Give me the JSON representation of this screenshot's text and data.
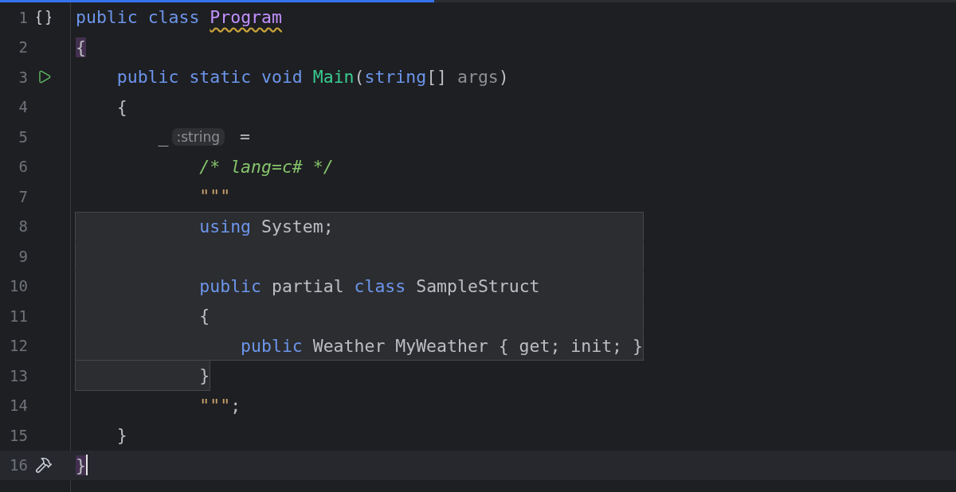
{
  "progress": {
    "level": 0.454
  },
  "lines": [
    {
      "number": "1",
      "gutter_icon": {
        "kind": "braces"
      },
      "current": false,
      "injected": false,
      "tokens": [
        {
          "kind": "keyword",
          "text": "public"
        },
        {
          "kind": "keyword",
          "text": " class"
        },
        {
          "kind": "class",
          "text": " Program",
          "warning": true
        }
      ]
    },
    {
      "number": "2",
      "current": false,
      "injected": false,
      "tokens": [
        {
          "kind": "plain",
          "text": "{",
          "matched": true
        }
      ]
    },
    {
      "number": "3",
      "gutter_icon": {
        "kind": "run"
      },
      "current": false,
      "injected": false,
      "tokens": [
        {
          "kind": "keyword",
          "text": "    public"
        },
        {
          "kind": "keyword",
          "text": " static"
        },
        {
          "kind": "keyword",
          "text": " void"
        },
        {
          "kind": "method",
          "text": " Main"
        },
        {
          "kind": "plain",
          "text": "("
        },
        {
          "kind": "keyword",
          "text": "string"
        },
        {
          "kind": "plain",
          "text": "[]"
        },
        {
          "kind": "param",
          "text": " args"
        },
        {
          "kind": "plain",
          "text": ")"
        }
      ]
    },
    {
      "number": "4",
      "current": false,
      "injected": false,
      "tokens": [
        {
          "kind": "plain",
          "text": "    {"
        }
      ]
    },
    {
      "number": "5",
      "current": false,
      "injected": false,
      "tokens": [
        {
          "kind": "plain",
          "text": "        _"
        },
        {
          "kind": "hint",
          "text": ":string"
        },
        {
          "kind": "plain",
          "text": " ="
        }
      ]
    },
    {
      "number": "6",
      "current": false,
      "injected": false,
      "tokens": [
        {
          "kind": "comment",
          "text": "            /* lang=c# */"
        }
      ]
    },
    {
      "number": "7",
      "current": false,
      "injected": false,
      "tokens": [
        {
          "kind": "string",
          "text": "            \"\"\""
        }
      ]
    },
    {
      "number": "8",
      "current": false,
      "injected": true,
      "tokens": [
        {
          "kind": "keyword",
          "text": "            using"
        },
        {
          "kind": "plain",
          "text": " System;"
        }
      ]
    },
    {
      "number": "9",
      "current": false,
      "injected": true
    },
    {
      "number": "10",
      "current": false,
      "injected": true,
      "tokens": [
        {
          "kind": "keyword",
          "text": "            public"
        },
        {
          "kind": "plain",
          "text": " partial"
        },
        {
          "kind": "keyword",
          "text": " class"
        },
        {
          "kind": "plain",
          "text": " SampleStruct"
        }
      ]
    },
    {
      "number": "11",
      "current": false,
      "injected": true,
      "tokens": [
        {
          "kind": "plain",
          "text": "            {"
        }
      ]
    },
    {
      "number": "12",
      "current": false,
      "injected": true,
      "tokens": [
        {
          "kind": "keyword",
          "text": "                public"
        },
        {
          "kind": "plain",
          "text": " Weather MyWeather { get; init; }"
        }
      ]
    },
    {
      "number": "13",
      "current": false,
      "injected": true,
      "tokens": [
        {
          "kind": "plain",
          "text": "            }"
        }
      ]
    },
    {
      "number": "14",
      "current": false,
      "injected": false,
      "tokens": [
        {
          "kind": "string",
          "text": "            \"\"\""
        },
        {
          "kind": "plain",
          "text": ";"
        }
      ]
    },
    {
      "number": "15",
      "current": false,
      "injected": false,
      "tokens": [
        {
          "kind": "plain",
          "text": "    }"
        }
      ]
    },
    {
      "number": "16",
      "gutter_icon": {
        "kind": "build"
      },
      "current": true,
      "caret": true,
      "injected": false,
      "tokens": [
        {
          "kind": "plain",
          "text": "}",
          "matched": true
        }
      ]
    }
  ]
}
